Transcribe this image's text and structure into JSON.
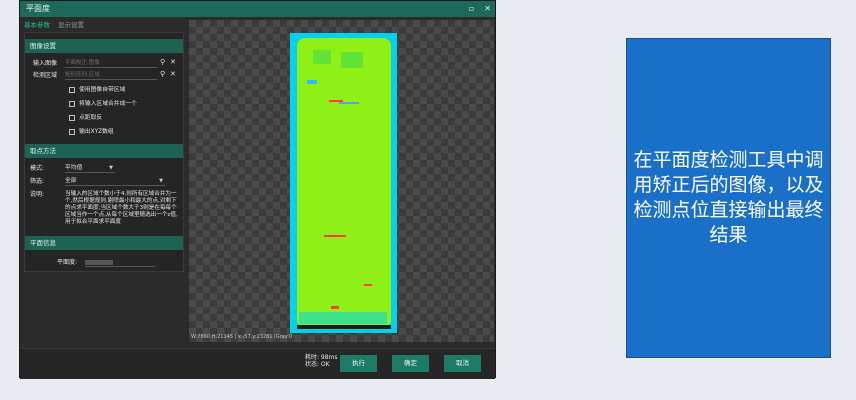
{
  "window": {
    "title": "平面度",
    "controls": [
      "▫",
      "✕"
    ]
  },
  "tabs": [
    {
      "label": "基本参数"
    },
    {
      "label": "显示设置"
    }
  ],
  "image_settings": {
    "section_title": "图像设置",
    "input_image_label": "输入图像",
    "input_image_placeholder": "平面校正.图像",
    "detect_region_label": "检测区域",
    "detect_region_placeholder": "矩形阵列.区域",
    "options": [
      "使用图像自带区域",
      "将输入区域合并成一个",
      "点距取反",
      "输出XYZ数组"
    ]
  },
  "sampling": {
    "section_title": "取点方法",
    "mode_label": "模式:",
    "mode_value": "平均值",
    "filter_label": "筛选:",
    "filter_value": "全部",
    "desc_label": "说明:",
    "desc_text": "当输入的区域个数小于4,则所有区域合并为一个,然后根据规则,剔除最小和最大的点,对剩下的点求平面度;当区域个数大于3则是在每每个区域当作一个点,从每个区域里随选出一个z值,用于拟合平面求平面度"
  },
  "flatness": {
    "section_title": "平面信息",
    "label": "平面度:"
  },
  "viewer": {
    "status_text": "W:7860 H:21145 | x:-57,y:13281 |Gray:0"
  },
  "footer": {
    "time_text": "耗时: 98ms",
    "status_text": "状态: OK",
    "run_label": "执行",
    "ok_label": "确定",
    "cancel_label": "取消"
  },
  "callout": {
    "text": "在平面度检测工具中调用矫正后的图像，以及检测点位直接输出最终结果"
  },
  "colors": {
    "accent": "#1c7c67",
    "callout_bg": "#1a6fc9",
    "heatmap_main": "#8ef016"
  }
}
